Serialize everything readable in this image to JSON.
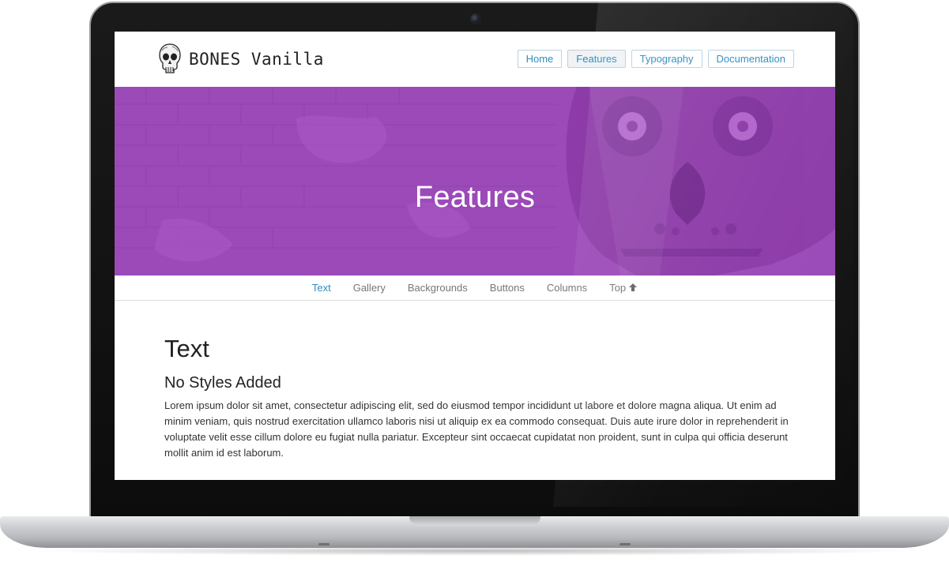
{
  "site": {
    "title": "BONES Vanilla"
  },
  "nav": {
    "items": [
      {
        "label": "Home",
        "active": false
      },
      {
        "label": "Features",
        "active": true
      },
      {
        "label": "Typography",
        "active": false
      },
      {
        "label": "Documentation",
        "active": false
      }
    ]
  },
  "hero": {
    "title": "Features",
    "color": "#9b4ab8"
  },
  "subnav": {
    "items": [
      "Text",
      "Gallery",
      "Backgrounds",
      "Buttons",
      "Columns"
    ],
    "active": "Text",
    "top_label": "Top",
    "top_icon": "arrow-up-icon"
  },
  "content": {
    "heading": "Text",
    "subheading": "No Styles Added",
    "paragraph": "Lorem ipsum dolor sit amet, consectetur adipiscing elit, sed do eiusmod tempor incididunt ut labore et dolore magna aliqua. Ut enim ad minim veniam, quis nostrud exercitation ullamco laboris nisi ut aliquip ex ea commodo consequat. Duis aute irure dolor in reprehenderit in voluptate velit esse cillum dolore eu fugiat nulla pariatur. Excepteur sint occaecat cupidatat non proident, sunt in culpa qui officia deserunt mollit anim id est laborum."
  },
  "colors": {
    "link": "#2e8dbf",
    "hero": "#9b4ab8"
  }
}
